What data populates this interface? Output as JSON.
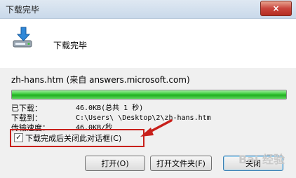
{
  "window": {
    "title": "下载完毕",
    "close_icon": "×"
  },
  "header": {
    "title": "下载完毕",
    "icon": "download-arrow-icon"
  },
  "source": "zh-hans.htm (来自 answers.microsoft.com)",
  "progress": {
    "percent": 100
  },
  "details": [
    {
      "label": "已下载：",
      "value": "46.0KB(总共 1 秒)"
    },
    {
      "label": "下载到：",
      "value": "C:\\Users\\        \\Desktop\\2\\zh-hans.htm"
    },
    {
      "label": "传输速度：",
      "value": "46.0KB/秒"
    }
  ],
  "checkbox": {
    "checked": true,
    "check_mark": "✓",
    "label": "下载完成后关闭此对话框(C)"
  },
  "buttons": {
    "open": "打开(O)",
    "open_folder": "打开文件夹(F)",
    "close": "关闭"
  },
  "watermark": "Bai 经验",
  "colors": {
    "highlight_border": "#c8201b",
    "progress_fill": "#39c739"
  }
}
